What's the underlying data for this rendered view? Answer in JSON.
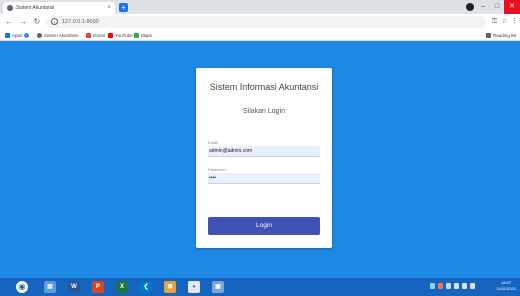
{
  "browser": {
    "tab_title": "Sistem Akuntansi",
    "tab_close": "×",
    "new_tab": "+",
    "url": "127.0.0.1:8000",
    "bookmarks": [
      "Apps",
      "Sistem Akuntansi",
      "Gmail",
      "YouTube",
      "Maps"
    ],
    "reading_list": "Reading list"
  },
  "login": {
    "title": "Sistem Informasi Akuntansi",
    "subtitle": "Silakan Login",
    "email_label": "Email",
    "email_value": "admin@admin.com",
    "password_label": "Password",
    "password_value": "••••",
    "button": "Login"
  },
  "taskbar": {
    "time": "18:07",
    "date": "14/11/2021"
  },
  "colors": {
    "page_bg": "#1e88e5",
    "button": "#3f51b5",
    "taskbar": "#1565c0"
  }
}
